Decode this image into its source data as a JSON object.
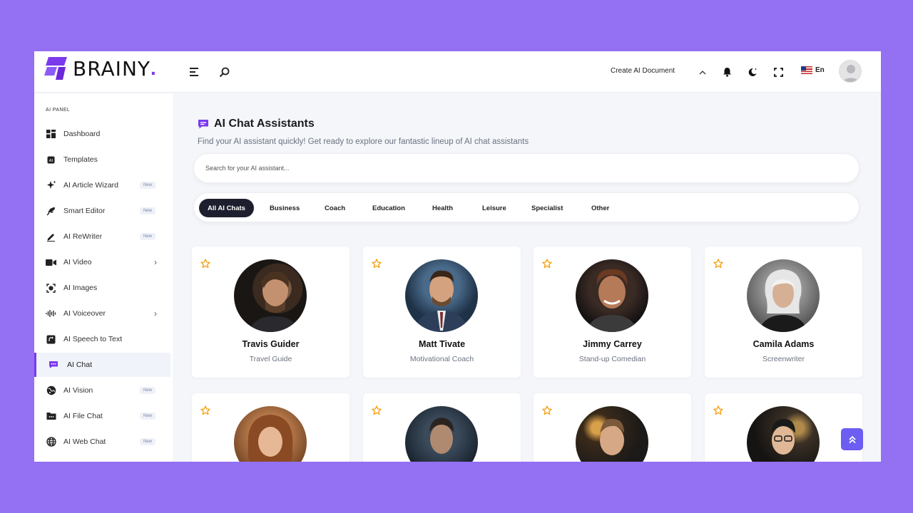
{
  "app": {
    "logo_text": "BRAINY",
    "logo_dot": "."
  },
  "header": {
    "create_document": "Create AI Document",
    "language": "En"
  },
  "sidebar": {
    "panel_title": "AI PANEL",
    "items": [
      {
        "label": "Dashboard"
      },
      {
        "label": "Templates"
      },
      {
        "label": "AI Article Wizard",
        "badge": "New"
      },
      {
        "label": "Smart Editor",
        "badge": "New"
      },
      {
        "label": "AI ReWriter",
        "badge": "New"
      },
      {
        "label": "AI Video"
      },
      {
        "label": "AI Images"
      },
      {
        "label": "AI Voiceover"
      },
      {
        "label": "AI Speech to Text"
      },
      {
        "label": "AI Chat"
      },
      {
        "label": "AI Vision",
        "badge": "New"
      },
      {
        "label": "AI File Chat",
        "badge": "New"
      },
      {
        "label": "AI Web Chat",
        "badge": "New"
      }
    ]
  },
  "main": {
    "title": "AI Chat Assistants",
    "subtitle": "Find your AI assistant quickly! Get ready to explore our fantastic lineup of AI chat assistants",
    "search_placeholder": "Search for your AI assistant...",
    "tabs": [
      "All AI Chats",
      "Business",
      "Coach",
      "Education",
      "Health",
      "Leisure",
      "Specialist",
      "Other"
    ],
    "cards": [
      {
        "name": "Travis Guider",
        "role": "Travel Guide"
      },
      {
        "name": "Matt Tivate",
        "role": "Motivational Coach"
      },
      {
        "name": "Jimmy Carrey",
        "role": "Stand-up Comedian"
      },
      {
        "name": "Camila Adams",
        "role": "Screenwriter"
      },
      {
        "name": "",
        "role": ""
      },
      {
        "name": "",
        "role": ""
      },
      {
        "name": "",
        "role": ""
      },
      {
        "name": "",
        "role": ""
      }
    ]
  },
  "colors": {
    "accent": "#7c3aed",
    "background": "#9470f2",
    "active_tab": "#1e1f2e",
    "star": "#f59e0b"
  }
}
